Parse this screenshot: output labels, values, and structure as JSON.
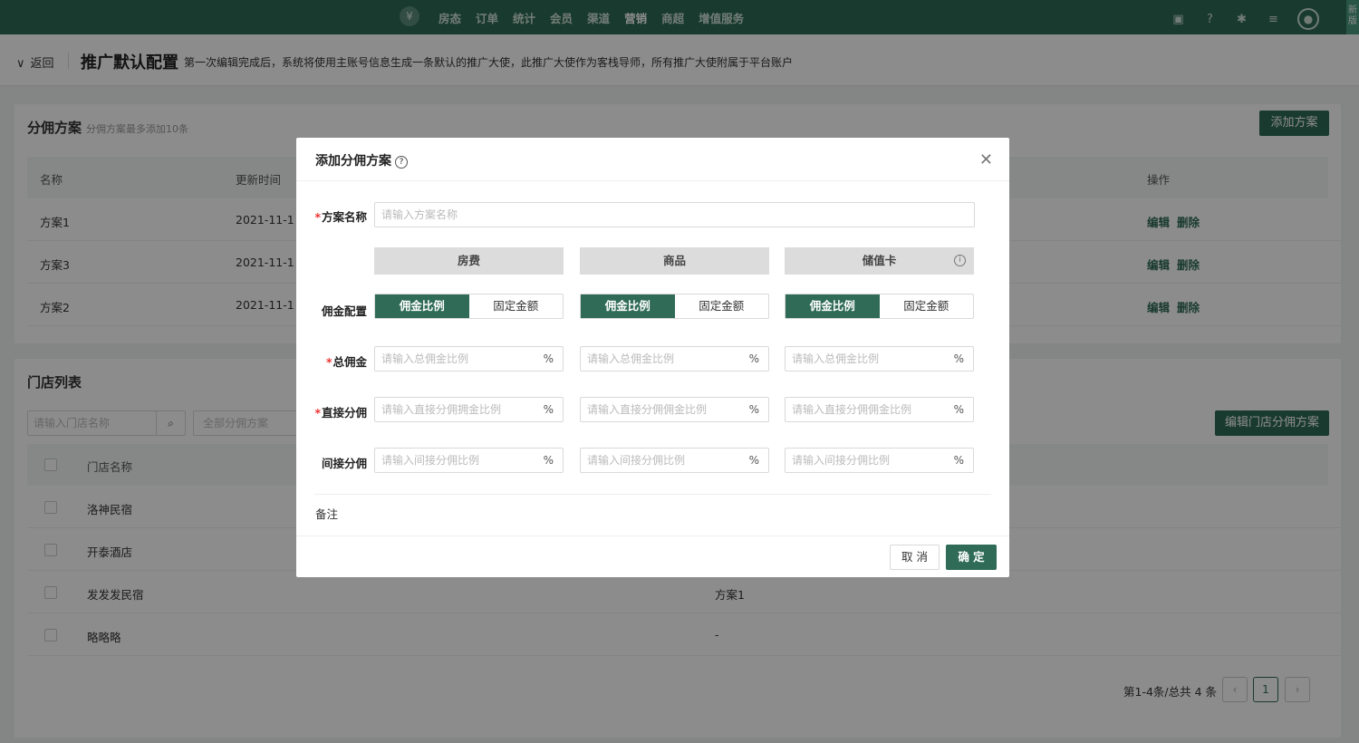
{
  "topbar": {
    "logo": "¥",
    "nav": [
      "房态",
      "订单",
      "统计",
      "会员",
      "渠道",
      "营销",
      "商超",
      "增值服务"
    ],
    "active": "营销",
    "corner": "新版"
  },
  "header": {
    "back": "返回",
    "title": "推广默认配置",
    "desc": "第一次编辑完成后，系统将使用主账号信息生成一条默认的推广大使，此推广大使作为客栈导师，所有推广大使附属于平台账户"
  },
  "plans": {
    "title": "分佣方案",
    "sub": "分佣方案最多添加10条",
    "add": "添加方案",
    "cols": [
      "名称",
      "更新时间",
      "操作"
    ],
    "rows": [
      {
        "name": "方案1",
        "time": "2021-11-1"
      },
      {
        "name": "方案3",
        "time": "2021-11-1"
      },
      {
        "name": "方案2",
        "time": "2021-11-1"
      }
    ],
    "edit": "编辑",
    "del": "删除"
  },
  "stores": {
    "title": "门店列表",
    "search_placeholder": "请输入门店名称",
    "filter": "全部分佣方案",
    "edit_btn": "编辑门店分佣方案",
    "col_name": "门店名称",
    "rows": [
      {
        "name": "洛神民宿",
        "plan": ""
      },
      {
        "name": "开泰酒店",
        "plan": ""
      },
      {
        "name": "发发发民宿",
        "plan": "方案1"
      },
      {
        "name": "略略略",
        "plan": "-"
      }
    ],
    "pager_text": "第1-4条/总共 4 条",
    "page": "1"
  },
  "modal": {
    "title": "添加分佣方案",
    "name_label": "方案名称",
    "name_placeholder": "请输入方案名称",
    "columns": [
      "房费",
      "商品",
      "储值卡"
    ],
    "config_label": "佣金配置",
    "seg_on": "佣金比例",
    "seg_off": "固定金额",
    "total_label": "总佣金",
    "total_placeholder": "请输入总佣金比例",
    "direct_label": "直接分佣",
    "direct_placeholders": [
      "请输入直接分佣拥金比例",
      "请输入直接分佣佣金比例",
      "请输入直接分佣佣金比例"
    ],
    "indirect_label": "间接分佣",
    "indirect_placeholder": "请输入间接分佣比例",
    "unit": "%",
    "note_label": "备注",
    "cancel": "取 消",
    "ok": "确 定"
  }
}
